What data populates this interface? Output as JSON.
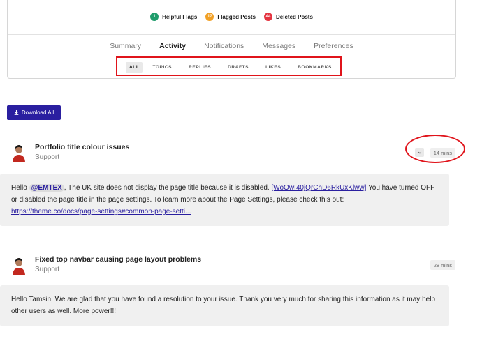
{
  "stats": [
    {
      "count": "1",
      "label": "Helpful Flags",
      "color": "#1f9c6b"
    },
    {
      "count": "17",
      "label": "Flagged Posts",
      "color": "#f1a025"
    },
    {
      "count": "44",
      "label": "Deleted Posts",
      "color": "#e4333f"
    }
  ],
  "main_tabs": [
    "Summary",
    "Activity",
    "Notifications",
    "Messages",
    "Preferences"
  ],
  "active_main_tab": "Activity",
  "sub_tabs": [
    "ALL",
    "TOPICS",
    "REPLIES",
    "DRAFTS",
    "LIKES",
    "BOOKMARKS"
  ],
  "active_sub_tab": "ALL",
  "download_button": {
    "label": "Download All",
    "icon": "download-icon"
  },
  "posts": [
    {
      "title": "Portfolio title colour issues",
      "category": "Support",
      "time": "14 mins",
      "excerpt": {
        "greeting": "Hello",
        "mention": "@EMTEX",
        "text1": ", The UK site does not display the page title because it is disabled.",
        "link1": "[WoOwI40jQrChD6RkUxKlww]",
        "text2": "You have turned OFF or disabled the page title in the page settings. To learn more about the Page Settings, please check this out:",
        "link2": "https://theme.co/docs/page-settings#common-page-setti..."
      }
    },
    {
      "title": "Fixed top navbar causing page layout problems",
      "category": "Support",
      "time": "28 mins",
      "excerpt": {
        "text": "Hello Tamsin, We are glad that you have found a resolution to your issue. Thank you very much for sharing this information as it may help other users as well. More power!!!"
      }
    }
  ],
  "colors": {
    "accent": "#2a1fa0",
    "annotation": "#e0141b"
  }
}
